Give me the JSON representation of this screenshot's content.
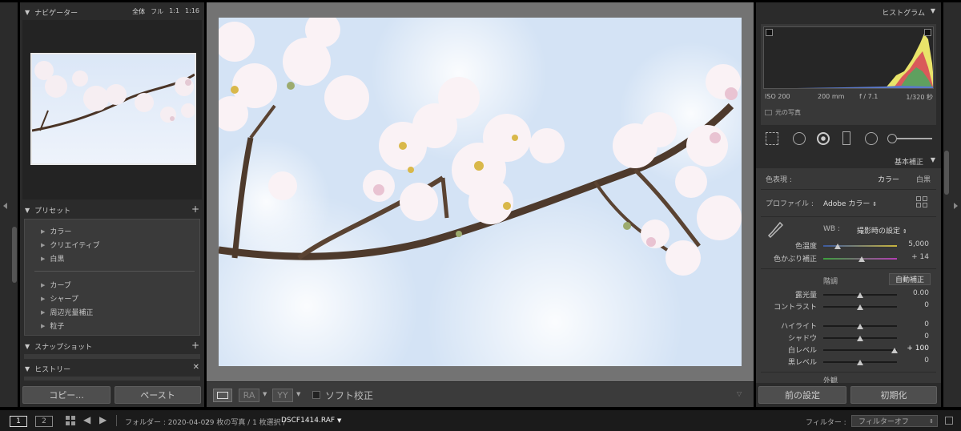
{
  "left_panel": {
    "navigator": {
      "title": "ナビゲーター",
      "zoom_options": [
        "全体",
        "フル",
        "1:1",
        "1:16"
      ]
    },
    "presets": {
      "title": "プリセット",
      "group1": [
        "カラー",
        "クリエイティブ",
        "白黒"
      ],
      "group2": [
        "カーブ",
        "シャープ",
        "周辺光量補正",
        "粒子"
      ]
    },
    "snapshot_title": "スナップショット",
    "history_title": "ヒストリー",
    "copy_label": "コピー...",
    "paste_label": "ペースト"
  },
  "toolbar": {
    "ra": "RA",
    "yy": "YY",
    "soft_proof": "ソフト校正"
  },
  "right_panel": {
    "histogram": {
      "title": "ヒストグラム",
      "iso": "ISO 200",
      "focal": "200 mm",
      "aperture": "f / 7.1",
      "shutter": "1/320 秒",
      "original_photo": "元の写真"
    },
    "basic": {
      "title": "基本補正",
      "treatment_label": "色表現 :",
      "color_option": "カラー",
      "bw_option": "白黒",
      "profile_label": "プロファイル :",
      "profile_value": "Adobe カラー",
      "wb_label": "WB :",
      "wb_value": "撮影時の設定",
      "temp_label": "色温度",
      "temp_value": "5,000",
      "temp_pos": 0.2,
      "tint_label": "色かぶり補正",
      "tint_value": "+ 14",
      "tint_pos": 0.52,
      "tone_label": "階調",
      "auto_label": "自動補正",
      "sliders": [
        {
          "label": "露光量",
          "value": "0.00",
          "pos": 0.5
        },
        {
          "label": "コントラスト",
          "value": "0",
          "pos": 0.5
        }
      ],
      "sliders2": [
        {
          "label": "ハイライト",
          "value": "0",
          "pos": 0.5
        },
        {
          "label": "シャドウ",
          "value": "0",
          "pos": 0.5
        },
        {
          "label": "白レベル",
          "value": "+ 100",
          "pos": 0.97
        },
        {
          "label": "黒レベル",
          "value": "0",
          "pos": 0.5
        }
      ],
      "presence_label": "外観"
    },
    "prev_settings": "前の設定",
    "reset": "初期化"
  },
  "bottom_bar": {
    "screen1": "1",
    "screen2": "2",
    "folder_label": "フォルダー : 2020-04-02",
    "count": "29 枚の写真 / 1 枚選択 /",
    "filename": "DSCF1414.RAF",
    "filter_label": "フィルター :",
    "filter_value": "フィルターオフ"
  },
  "colors": {
    "panel": "#2b2b2b",
    "background": "#000000",
    "center": "#737373"
  }
}
